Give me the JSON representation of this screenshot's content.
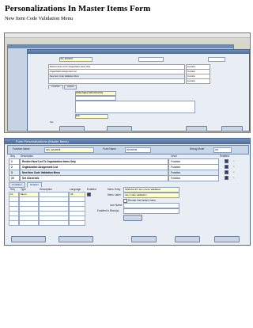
{
  "document": {
    "title": "Personalizations In Master Items Form",
    "subtitle": "New Item Code Validation Menu"
  },
  "screen1": {
    "header_field": "INV_WU0678",
    "rows": [
      "Restrict New List To Organization Items Only",
      "Organization Assignment List",
      "New Item Code Validation Menu",
      ""
    ],
    "row_types": [
      "Function",
      "Function",
      "Function",
      "Function"
    ],
    "selected_row": 2,
    "tabs": [
      "Condition",
      "Actions"
    ],
    "trigger_event_value": "WHEN-NEW-FORM-INSTANCE",
    "processing_mode_value": "Both",
    "context_level": "Site",
    "buttons": [
      "",
      "",
      "",
      ""
    ]
  },
  "screen2": {
    "title": "Form Personalizations (Master Items)",
    "function_name": "INV_WU0678",
    "form_name": "INVIDITM",
    "debug_mode": "Off",
    "labels": {
      "function_name": "Function Name",
      "form_name": "Form Name",
      "debug_mode": "Debug Mode",
      "seq": "Seq",
      "description": "Description",
      "level": "Level",
      "enabled": "Enabled",
      "type": "Type",
      "language": "Language",
      "menu_entry": "Menu Entry",
      "menu_label": "Menu Label",
      "render_line": "Render line before menu",
      "icon_name": "Icon Name",
      "enabled_in_blocks": "Enabled in Block(s)"
    },
    "rules": [
      {
        "seq": "1",
        "description": "Restrict New List To Organization Items Only",
        "level": "Function"
      },
      {
        "seq": "2",
        "description": "Organization Assignment List",
        "level": "Function"
      },
      {
        "seq": "3",
        "description": "New Item Code Validation Menu",
        "level": "Function"
      },
      {
        "seq": "10",
        "description": "Set Client Info",
        "level": "Function"
      }
    ],
    "selected_rule": 2,
    "tabs": [
      "Condition",
      "Actions"
    ],
    "action": {
      "seq": "10",
      "type": "Menu",
      "language": "All"
    },
    "menu_entry_value": "SPECIAL15: Item Code Validation",
    "menu_label_value": "Item Code Validation"
  }
}
